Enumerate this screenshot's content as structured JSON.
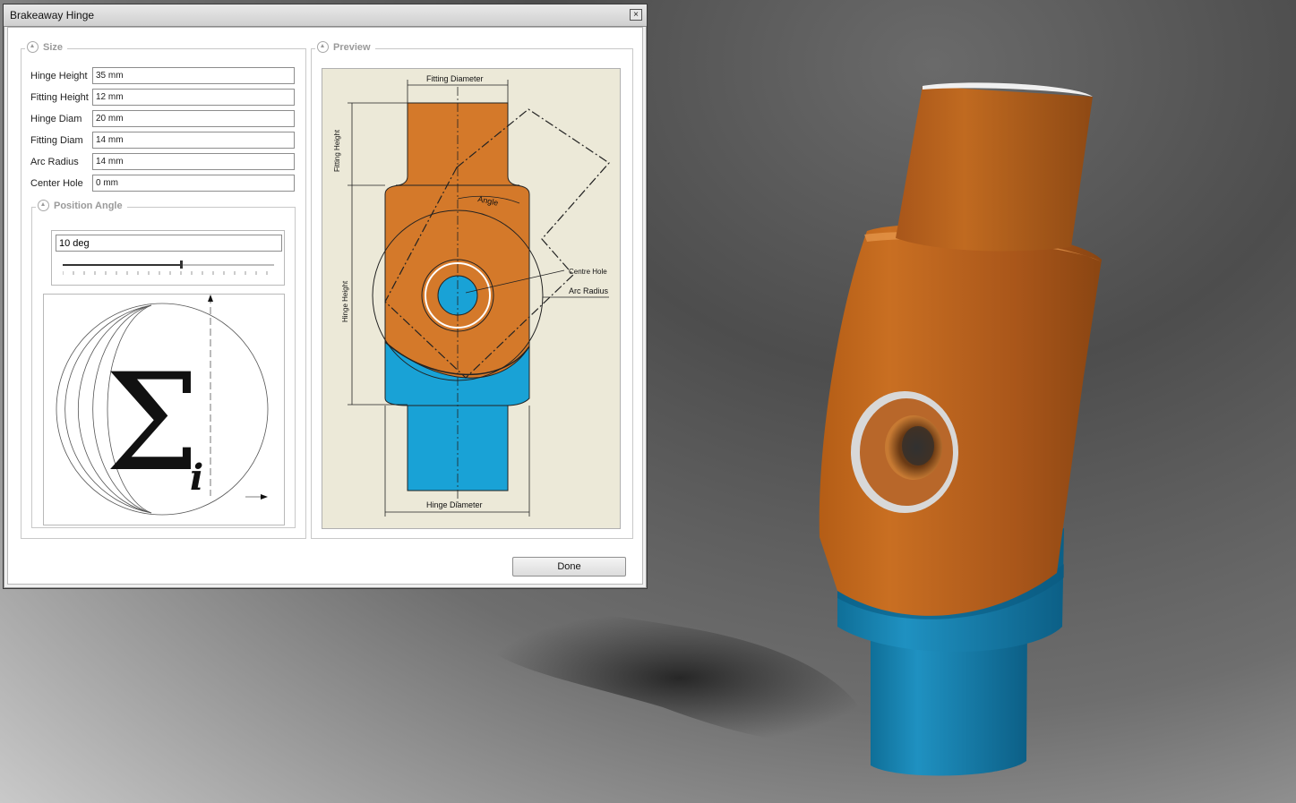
{
  "window": {
    "title": "Brakeaway Hinge",
    "close_glyph": "×"
  },
  "size_group": {
    "label": "Size",
    "fields": [
      {
        "label": "Hinge Height",
        "value": "35 mm"
      },
      {
        "label": "Fitting Height",
        "value": "12 mm"
      },
      {
        "label": "Hinge Diam",
        "value": "20 mm"
      },
      {
        "label": "Fitting Diam",
        "value": "14 mm"
      },
      {
        "label": "Arc Radius",
        "value": "14 mm"
      },
      {
        "label": "Center Hole",
        "value": "0 mm"
      }
    ]
  },
  "position_angle": {
    "label": "Position Angle",
    "value": "10 deg",
    "slider_fraction": 0.56,
    "diagram_symbol": "Σ",
    "diagram_subscript": "i"
  },
  "preview": {
    "label": "Preview",
    "annotations": {
      "fitting_diameter": "Fitting Diameter",
      "fitting_height": "Fitting Height",
      "angle": "Angle",
      "centre_hole": "Centre Hole",
      "arc_radius": "Arc Radius",
      "hinge_height": "Hinge Height",
      "hinge_diameter": "Hinge Diameter"
    }
  },
  "buttons": {
    "done": "Done"
  },
  "colors": {
    "orange": "#d4792a",
    "blue": "#19a2d6",
    "paper": "#ece9d8"
  }
}
